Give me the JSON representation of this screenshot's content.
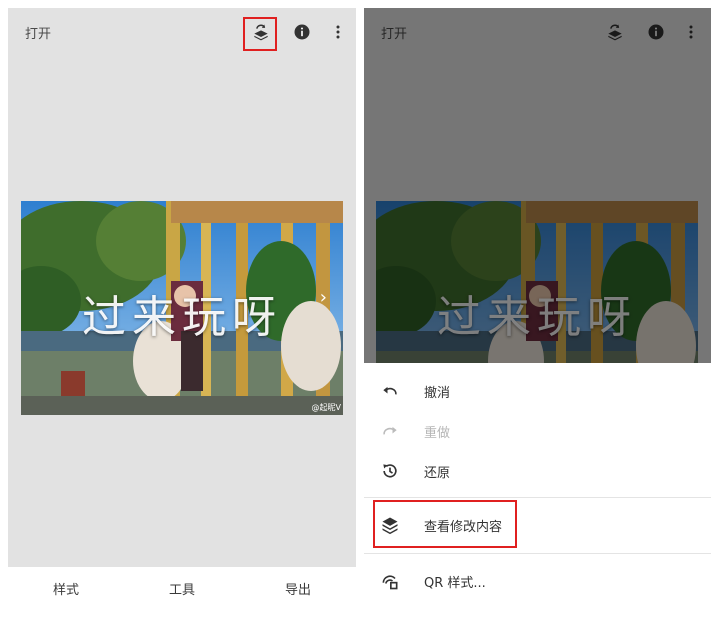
{
  "left_screen": {
    "topbar": {
      "open_label": "打开",
      "icons": [
        "layers-icon",
        "info-icon",
        "more-vert-icon"
      ]
    },
    "photo": {
      "overlay_text": "过来玩呀",
      "credit": "@起昵V"
    },
    "bottom_nav": {
      "styles_label": "样式",
      "tools_label": "工具",
      "export_label": "导出"
    }
  },
  "right_screen": {
    "topbar": {
      "open_label": "打开"
    },
    "photo": {
      "overlay_text": "过来玩呀"
    },
    "menu": {
      "items": [
        {
          "label": "撤消",
          "icon": "undo-icon",
          "enabled": true
        },
        {
          "label": "重做",
          "icon": "redo-icon",
          "enabled": false
        },
        {
          "label": "还原",
          "icon": "history-icon",
          "enabled": true
        },
        {
          "label": "查看修改内容",
          "icon": "layers-icon",
          "enabled": true
        },
        {
          "label": "QR 样式...",
          "icon": "qr-style-icon",
          "enabled": true
        }
      ]
    }
  },
  "colors": {
    "highlight": "#e02020",
    "app_background": "#e2e2e2",
    "icon": "#333333"
  }
}
